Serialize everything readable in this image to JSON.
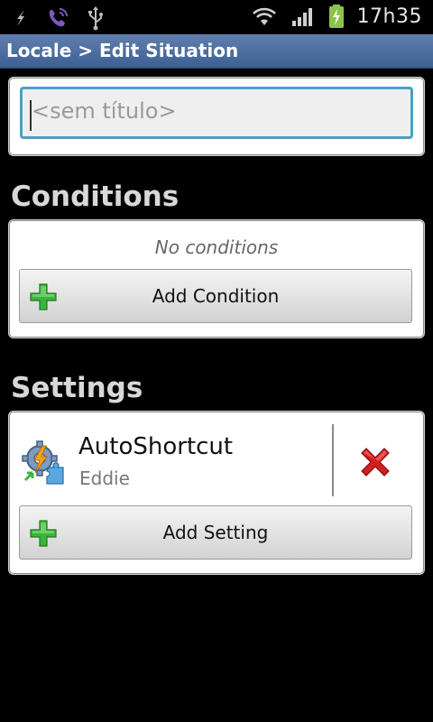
{
  "status_bar": {
    "time": "17h35",
    "icons": [
      "missed-call-icon",
      "viber-icon",
      "usb-icon",
      "wifi-icon",
      "signal-icon",
      "battery-charging-icon"
    ]
  },
  "title_bar": {
    "title": "Locale > Edit Situation"
  },
  "name_field": {
    "placeholder": "<sem título>",
    "value": ""
  },
  "conditions": {
    "title": "Conditions",
    "empty_text": "No conditions",
    "add_label": "Add Condition"
  },
  "settings": {
    "title": "Settings",
    "items": [
      {
        "name": "AutoShortcut",
        "subtitle": "Eddie",
        "icon": "gear-puzzle-icon"
      }
    ],
    "add_label": "Add Setting"
  },
  "colors": {
    "title_bar": "#4a6b9c",
    "input_focus": "#4aa1c5",
    "plus": "#3cb43c",
    "delete": "#d21e1e"
  }
}
